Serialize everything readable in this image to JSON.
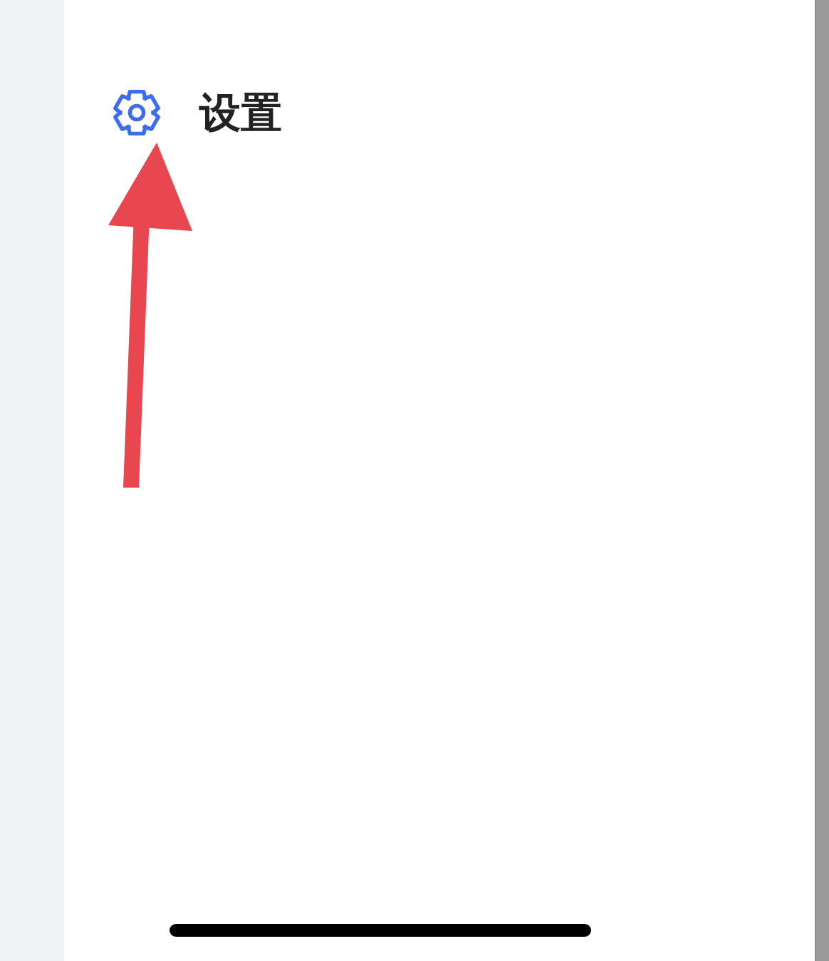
{
  "settings_item": {
    "label": "设置"
  }
}
